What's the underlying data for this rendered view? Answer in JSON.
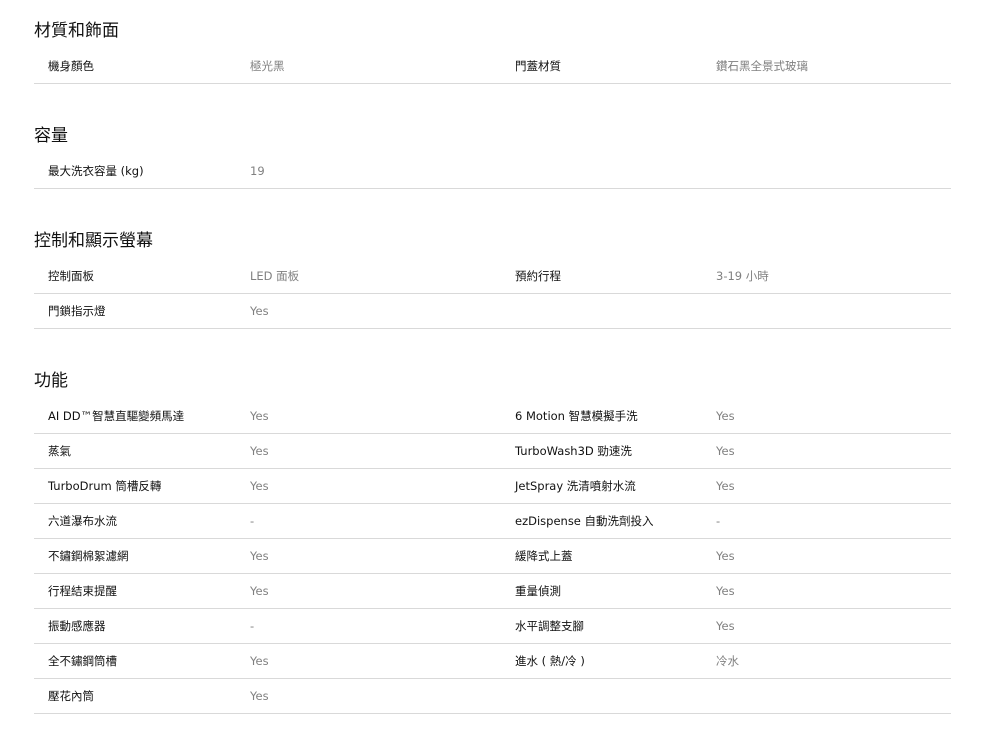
{
  "sections": [
    {
      "title": "材質和飾面",
      "rows": [
        {
          "l1": "機身顏色",
          "v1": "極光黑",
          "l2": "門蓋材質",
          "v2": "鑽石黑全景式玻璃"
        }
      ]
    },
    {
      "title": "容量",
      "rows": [
        {
          "l1": "最大洗衣容量 (kg)",
          "v1": "19",
          "l2": "",
          "v2": ""
        }
      ]
    },
    {
      "title": "控制和顯示螢幕",
      "rows": [
        {
          "l1": "控制面板",
          "v1": "LED 面板",
          "l2": "預約行程",
          "v2": "3-19 小時"
        },
        {
          "l1": "門鎖指示燈",
          "v1": "Yes",
          "l2": "",
          "v2": ""
        }
      ]
    },
    {
      "title": "功能",
      "rows": [
        {
          "l1": "AI DD™智慧直驅變頻馬達",
          "v1": "Yes",
          "l2": "6 Motion 智慧模擬手洗",
          "v2": "Yes"
        },
        {
          "l1": "蒸氣",
          "v1": "Yes",
          "l2": "TurboWash3D 勁速洗",
          "v2": "Yes"
        },
        {
          "l1": "TurboDrum 筒槽反轉",
          "v1": "Yes",
          "l2": "JetSpray 洗清噴射水流",
          "v2": "Yes"
        },
        {
          "l1": "六道瀑布水流",
          "v1": "-",
          "l2": "ezDispense 自動洗劑投入",
          "v2": "-"
        },
        {
          "l1": "不鏽鋼棉絮濾網",
          "v1": "Yes",
          "l2": "緩降式上蓋",
          "v2": "Yes"
        },
        {
          "l1": "行程結束提醒",
          "v1": "Yes",
          "l2": "重量偵測",
          "v2": "Yes"
        },
        {
          "l1": "振動感應器",
          "v1": "-",
          "l2": "水平調整支腳",
          "v2": "Yes"
        },
        {
          "l1": "全不鏽鋼筒槽",
          "v1": "Yes",
          "l2": "進水 ( 熱/冷 )",
          "v2": "冷水"
        },
        {
          "l1": "壓花內筒",
          "v1": "Yes",
          "l2": "",
          "v2": ""
        }
      ]
    }
  ]
}
